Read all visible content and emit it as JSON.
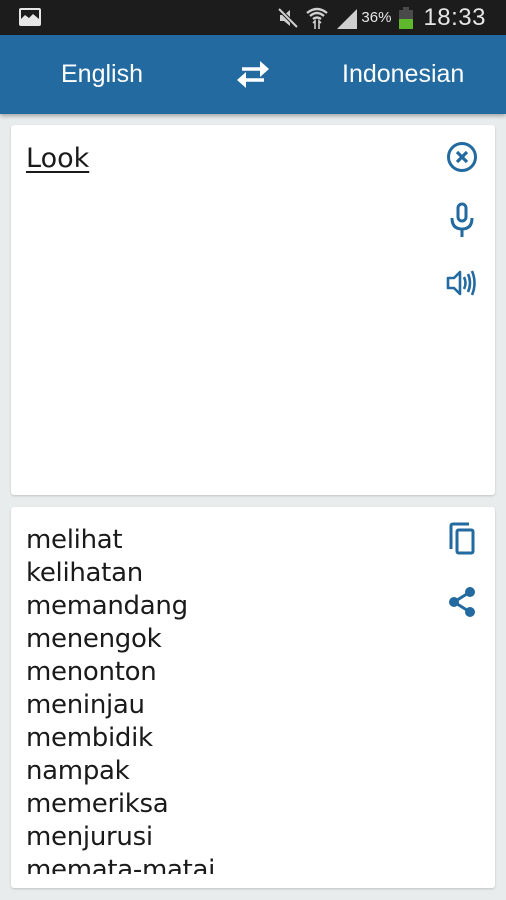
{
  "status_bar": {
    "notification_icon": "gallery-icon",
    "icons": [
      "mute-icon",
      "wifi-icon",
      "signal-icon"
    ],
    "battery_percent_label": "36%",
    "battery_level": 0.36,
    "time": "18:33",
    "colors": {
      "background": "#1c1c1c",
      "battery": "#5fb82c"
    }
  },
  "top_bar": {
    "source_language": "English",
    "target_language": "Indonesian",
    "swap_icon": "swap-arrows-icon",
    "color": "#226a9f"
  },
  "input_card": {
    "text": "Look",
    "actions": [
      {
        "name": "clear",
        "icon": "clear-circle-icon"
      },
      {
        "name": "microphone",
        "icon": "microphone-icon"
      },
      {
        "name": "speak",
        "icon": "speaker-icon"
      }
    ]
  },
  "output_card": {
    "translations": [
      "melihat",
      "kelihatan",
      "memandang",
      "menengok",
      "menonton",
      "meninjau",
      "membidik",
      "nampak",
      "memeriksa",
      "menjurusi",
      "memata-matai"
    ],
    "actions": [
      {
        "name": "copy",
        "icon": "copy-icon"
      },
      {
        "name": "share",
        "icon": "share-icon"
      }
    ]
  },
  "accent_color": "#226a9f"
}
